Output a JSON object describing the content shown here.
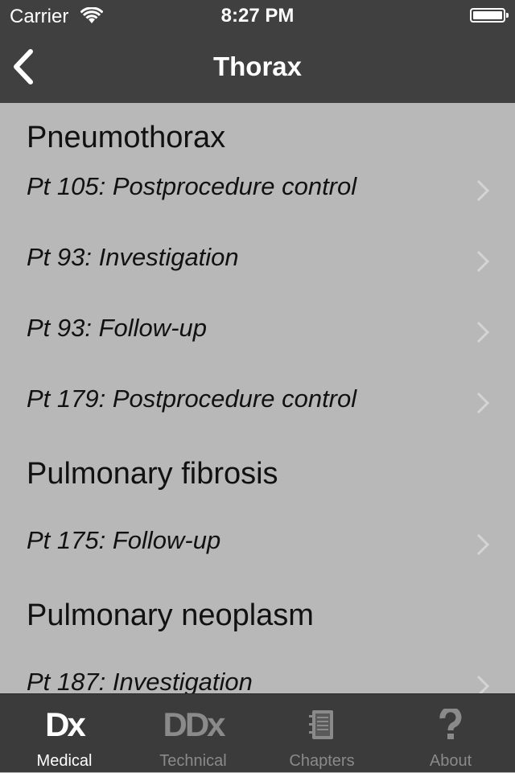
{
  "status": {
    "carrier": "Carrier",
    "time": "8:27 PM"
  },
  "nav": {
    "title": "Thorax"
  },
  "sections": [
    {
      "title": "Pneumothorax",
      "rows": [
        "Pt 105: Postprocedure control",
        "Pt 93: Investigation",
        "Pt 93: Follow-up",
        "Pt 179: Postprocedure control"
      ]
    },
    {
      "title": "Pulmonary fibrosis",
      "rows": [
        "Pt 175: Follow-up"
      ]
    },
    {
      "title": "Pulmonary neoplasm",
      "rows": [
        "Pt 187: Investigation"
      ]
    }
  ],
  "tabs": [
    {
      "label": "Medical",
      "icon_text": "Dx",
      "active": true
    },
    {
      "label": "Technical",
      "icon_text": "DDx",
      "active": false
    },
    {
      "label": "Chapters",
      "icon": "notebook-icon",
      "active": false
    },
    {
      "label": "About",
      "icon": "question-icon",
      "active": false
    }
  ],
  "colors": {
    "bar_bg": "#404040",
    "content_bg": "#b8b8b8",
    "active_tab": "#ffffff",
    "inactive_tab": "#8a8a8a"
  }
}
